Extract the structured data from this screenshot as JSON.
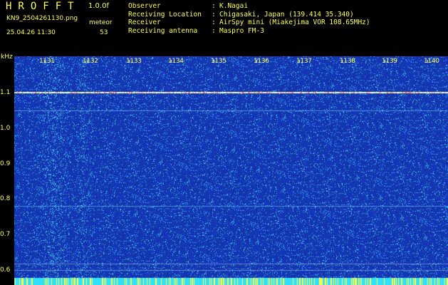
{
  "header": {
    "brand": "HROFFT",
    "version": "1.0.0f",
    "filename": "KN9_2504261130.png",
    "meteor_label": "meteor",
    "timestamp": "25.04.26 11:30",
    "meteor_count": "53"
  },
  "info": {
    "rows": [
      {
        "key": "Observer",
        "sep": ":",
        "value": "K.Nagai"
      },
      {
        "key": "Receiving Location",
        "sep": ":",
        "value": "Chigasaki, Japan (139.414 35.340)"
      },
      {
        "key": "Receiver",
        "sep": ":",
        "value": "AirSpy mini (Miakejima VOR 108.65MHz)"
      },
      {
        "key": "Receiving antenna",
        "sep": ":",
        "value": "Maspro FM-3"
      }
    ]
  },
  "yaxis": {
    "unit": "kHz",
    "ticks": [
      "1.1",
      "1.0",
      "0.9",
      "0.8",
      "0.7",
      "0.6"
    ]
  },
  "xaxis": {
    "ticks": [
      "1131",
      "1132",
      "1133",
      "1134",
      "1135",
      "1136",
      "1137",
      "1138",
      "1139",
      "1140"
    ]
  },
  "colors": {
    "label": "#ffff55",
    "background": "#000000",
    "spectrogram_base": "#1a2fb0"
  }
}
